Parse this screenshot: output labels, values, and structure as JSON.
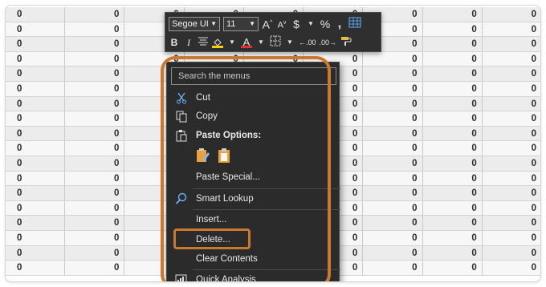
{
  "grid": {
    "cell_value": "0",
    "row_count": 18,
    "column_count": 9
  },
  "mini_toolbar": {
    "font_name": "Segoe UI",
    "font_size": "11",
    "increase_font": "A",
    "decrease_font": "A",
    "currency": "$",
    "percent": "%",
    "comma": ",",
    "bold": "B",
    "italic": "I",
    "font_color_letter": "A",
    "increase_decimal": "←.00",
    "decrease_decimal": ".00→",
    "colors": {
      "highlight_fill": "#f5d000",
      "font_color": "#e03030"
    }
  },
  "context_menu": {
    "search_placeholder": "Search the menus",
    "items": {
      "cut": "Cut",
      "copy": "Copy",
      "paste_options": "Paste Options:",
      "paste_special": "Paste Special...",
      "smart_lookup": "Smart Lookup",
      "insert": "Insert...",
      "delete": "Delete...",
      "clear_contents": "Clear Contents",
      "quick_analysis": "Quick Analysis"
    }
  },
  "annotation": {
    "color": "#c9792f"
  }
}
